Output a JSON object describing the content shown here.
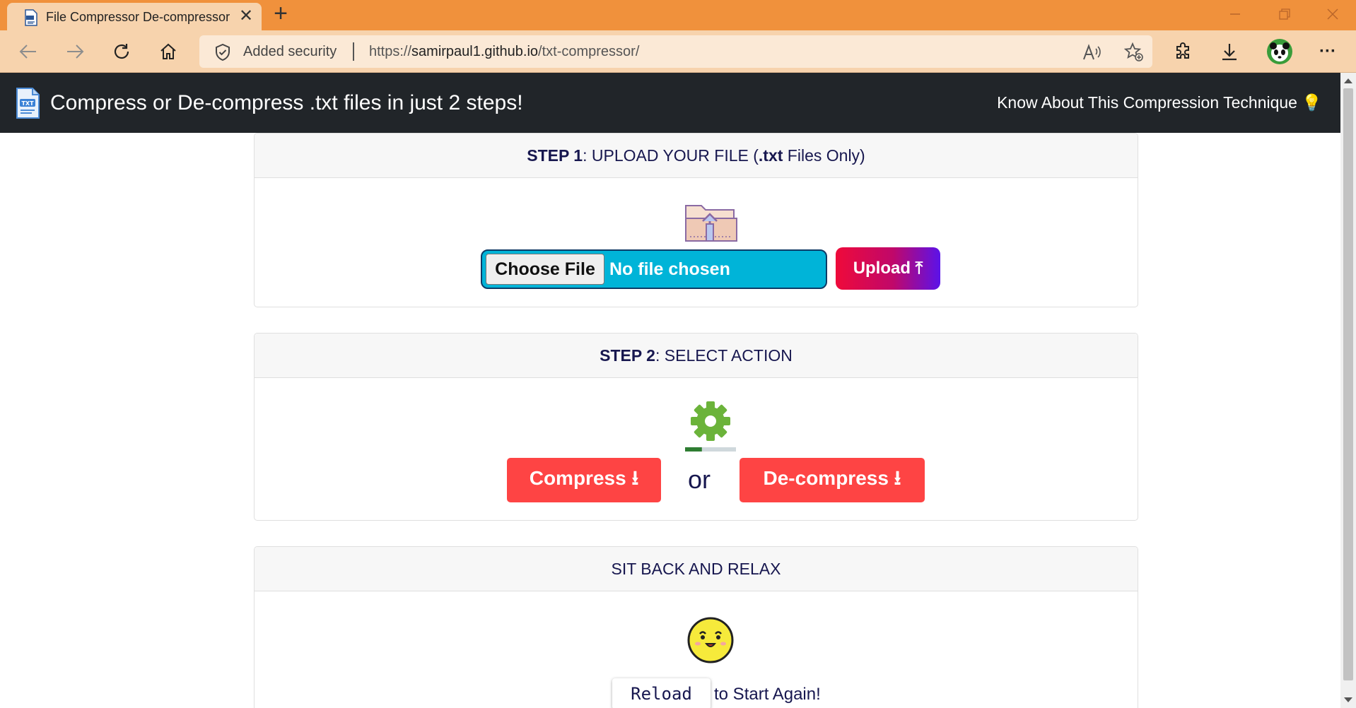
{
  "browser": {
    "tab_title": "File Compressor De-compressor",
    "tab_close": "✕",
    "new_tab": "+",
    "security_label": "Added security",
    "url_prefix": "https://",
    "url_host": "samirpaul1.github.io",
    "url_path": "/txt-compressor/",
    "menu_label": "···",
    "colors": {
      "tab_strip": "#f0913c",
      "toolbar": "#f7d3ad"
    }
  },
  "navbar": {
    "brand": "Compress or De-compress .txt files in just 2 steps!",
    "link": "Know About This Compression Technique 💡"
  },
  "step1": {
    "header_bold": "STEP 1",
    "header_text": ": UPLOAD YOUR FILE (",
    "header_ext": ".txt",
    "header_tail": " Files Only)",
    "choose_label": "Choose File",
    "file_status": "No file chosen",
    "upload_label": "Upload ⤒"
  },
  "step2": {
    "header_bold": "STEP 2",
    "header_text": ": SELECT ACTION",
    "compress_label": "Compress ⭳",
    "or_label": "or",
    "decompress_label": "De-compress ⭳",
    "progress_fraction": 0.33
  },
  "step3": {
    "header_text": "SIT BACK AND RELAX",
    "reload_label": "Reload",
    "reload_tail": "to Start Again!"
  },
  "colors": {
    "navbar": "#212529",
    "action_button": "#fe4444",
    "file_input": "#00b4d8",
    "text": "#17174f"
  }
}
